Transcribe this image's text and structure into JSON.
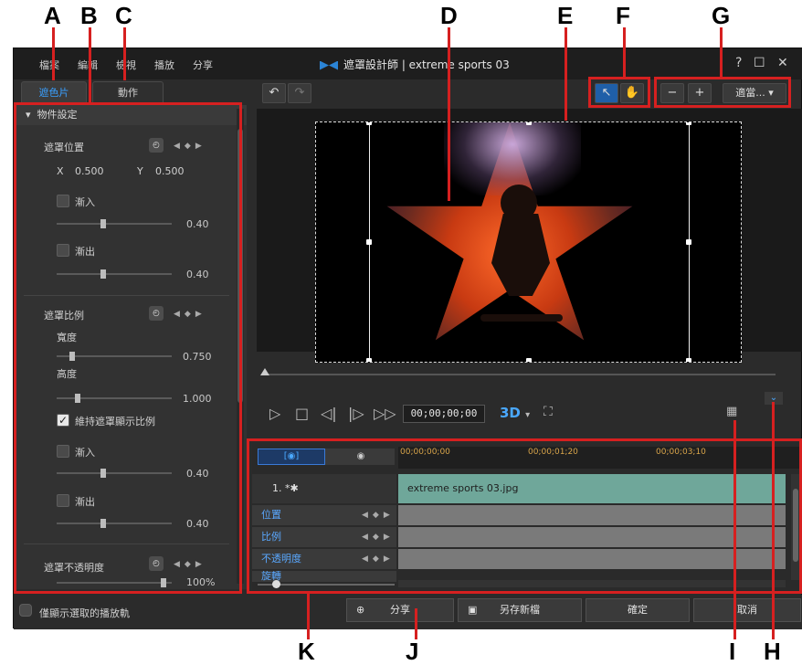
{
  "callouts": [
    "A",
    "B",
    "C",
    "D",
    "E",
    "F",
    "G",
    "H",
    "I",
    "J",
    "K"
  ],
  "window": {
    "menu": [
      "檔案",
      "編輯",
      "檢視",
      "播放",
      "分享"
    ],
    "title": "遮罩設計師 | extreme sports 03",
    "controls": {
      "help": "?",
      "maximize": "☐",
      "close": "✕"
    }
  },
  "tabs": {
    "mask": "遮色片",
    "motion": "動作"
  },
  "panel": {
    "section_title": "物件設定",
    "mask_position": {
      "label": "遮罩位置",
      "x_label": "X",
      "x_value": "0.500",
      "y_label": "Y",
      "y_value": "0.500"
    },
    "fade_in_1": {
      "label": "漸入",
      "value": "0.40"
    },
    "fade_out_1": {
      "label": "漸出",
      "value": "0.40"
    },
    "mask_scale": {
      "label": "遮罩比例",
      "width_label": "寬度",
      "width_value": "0.750",
      "height_label": "高度",
      "height_value": "1.000",
      "keep_ratio_label": "維持遮罩顯示比例"
    },
    "fade_in_2": {
      "label": "漸入",
      "value": "0.40"
    },
    "fade_out_2": {
      "label": "漸出",
      "value": "0.40"
    },
    "mask_opacity": {
      "label": "遮罩不透明度",
      "value": "100%"
    }
  },
  "toolbar": {
    "undo": "↶",
    "redo": "↷",
    "zoom_label": "適當..."
  },
  "player": {
    "timecode": "00;00;00;00",
    "mode_3d": "3D"
  },
  "timeline": {
    "ticks": [
      "00;00;00;00",
      "00;00;01;20",
      "00;00;03;10"
    ],
    "track_label": "1.",
    "clip_name": "extreme sports 03.jpg",
    "keyframe_tracks": [
      "位置",
      "比例",
      "不透明度",
      "旋轉"
    ]
  },
  "bottom": {
    "show_selected_label": "僅顯示選取的播放軌",
    "share_label": "分享",
    "save_as_label": "另存新檔",
    "ok_label": "確定",
    "cancel_label": "取消"
  },
  "colors": {
    "callout_line": "#d62020",
    "clip_fill": "#6fa79a",
    "accent": "#2b84d6"
  }
}
